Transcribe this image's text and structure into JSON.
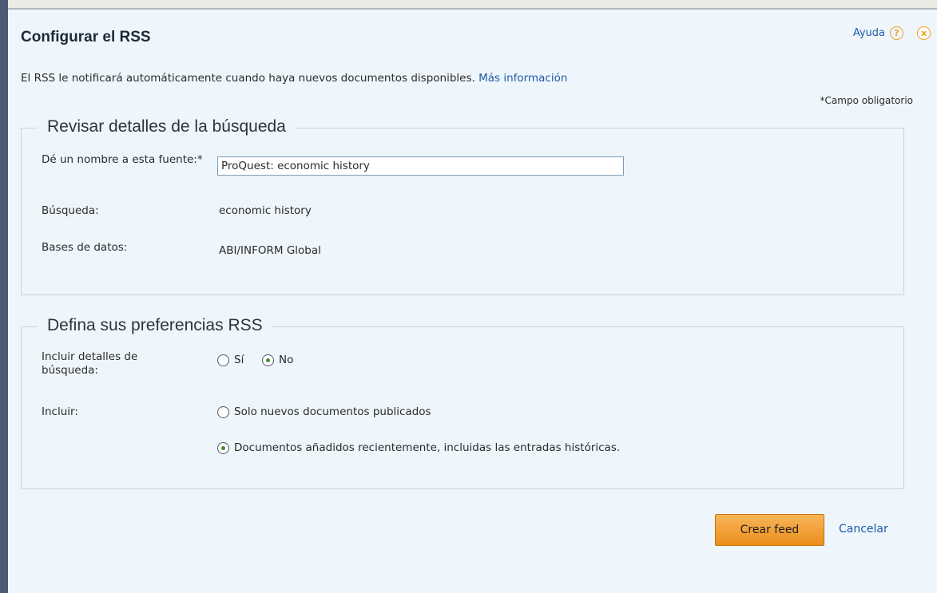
{
  "dialog": {
    "title": "Configurar el RSS",
    "help_label": "Ayuda",
    "help_icon": "?",
    "close_icon": "x",
    "intro_text": "El RSS le notificará automáticamente cuando haya nuevos documentos disponibles.",
    "intro_link": "Más información",
    "required_note": "*Campo obligatorio"
  },
  "review": {
    "legend": "Revisar detalles de la búsqueda",
    "name_label": "Dé un nombre a esta fuente:*",
    "name_value": "ProQuest: economic history",
    "search_label": "Búsqueda:",
    "search_value": "economic history",
    "db_label": "Bases de datos:",
    "db_value": "ABI/INFORM Global"
  },
  "prefs": {
    "legend": "Defina sus preferencias RSS",
    "include_details_label": "Incluir detalles de búsqueda:",
    "yes_label": "Sí",
    "no_label": "No",
    "include_label": "Incluir:",
    "option_new": "Solo nuevos documentos publicados",
    "option_recent": "Documentos añadidos recientemente, incluidas las entradas históricas."
  },
  "actions": {
    "create_label": "Crear feed",
    "cancel_label": "Cancelar"
  },
  "colors": {
    "accent": "#f0a020",
    "link": "#1e5aa8",
    "dialog_bg": "#eef6fb"
  }
}
